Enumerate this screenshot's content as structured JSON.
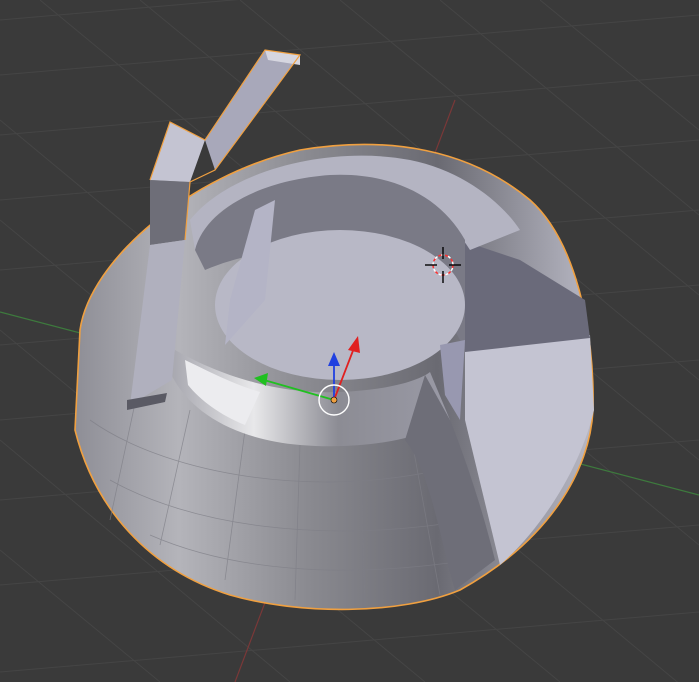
{
  "viewport": {
    "mode": "3D Viewport",
    "background_color": "#3a3a3a",
    "grid_color": "#444444",
    "x_axis_color": "#8a3a3a",
    "y_axis_color": "#3f8a3f"
  },
  "object": {
    "shape": "half-sphere-bowl-with-handle",
    "selected": true,
    "outline_color": "#f0a040",
    "base_color": "#a8a8b4"
  },
  "gizmo": {
    "x_axis_color": "#e02020",
    "y_axis_color": "#20c020",
    "z_axis_color": "#2040e0",
    "origin_color": "#f0a040"
  },
  "cursor_3d": {
    "icon": "3d-cursor-icon",
    "ring_colors": [
      "#ff3030",
      "#ffffff"
    ]
  }
}
